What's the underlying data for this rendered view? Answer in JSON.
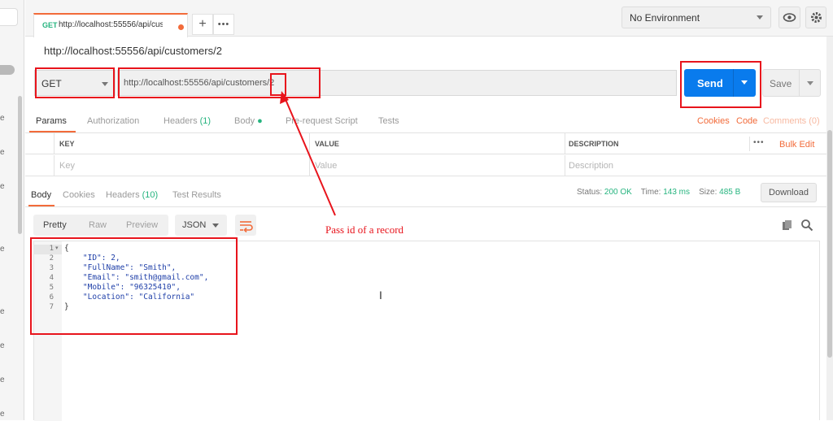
{
  "tab": {
    "method": "GET",
    "url": "http://localhost:55556/api/custor"
  },
  "tabbar": {
    "add_icon": "plus-icon",
    "more_icon": "ellipsis-icon"
  },
  "environment": {
    "selected": "No Environment"
  },
  "request": {
    "title": "http://localhost:55556/api/customers/2",
    "method": "GET",
    "url": "http://localhost:55556/api/customers/2",
    "send_label": "Send",
    "save_label": "Save"
  },
  "request_tabs": {
    "params": "Params",
    "authorization": "Authorization",
    "headers": "Headers",
    "headers_count": "(1)",
    "body": "Body",
    "pre_request": "Pre-request Script",
    "tests": "Tests",
    "cookies": "Cookies",
    "code": "Code",
    "comments": "Comments (0)"
  },
  "params_table": {
    "headers": [
      "KEY",
      "VALUE",
      "DESCRIPTION"
    ],
    "placeholders": [
      "Key",
      "Value",
      "Description"
    ],
    "bulk_edit": "Bulk Edit",
    "more": "•••"
  },
  "response_tabs": {
    "body": "Body",
    "cookies": "Cookies",
    "headers": "Headers",
    "headers_count": "(10)",
    "test_results": "Test Results"
  },
  "status": {
    "status_label": "Status:",
    "status_value": "200 OK",
    "time_label": "Time:",
    "time_value": "143 ms",
    "size_label": "Size:",
    "size_value": "485 B",
    "download": "Download"
  },
  "view_modes": {
    "pretty": "Pretty",
    "raw": "Raw",
    "preview": "Preview",
    "format": "JSON"
  },
  "code_lines": [
    "{",
    "    \"ID\": 2,",
    "    \"FullName\": \"Smith\",",
    "    \"Email\": \"smith@gmail.com\",",
    "    \"Mobile\": \"96325410\",",
    "    \"Location\": \"California\"",
    "}"
  ],
  "line_numbers": [
    "1",
    "2",
    "3",
    "4",
    "5",
    "6",
    "7"
  ],
  "annotation": {
    "text": "Pass id of a record",
    "color": "#e8141c"
  },
  "sidebar_fragments": [
    "e",
    "e",
    "e",
    "e",
    "e",
    "e",
    "e",
    "e"
  ],
  "colors": {
    "accent": "#f26b3a",
    "send": "#097bed",
    "success": "#26b47f"
  }
}
